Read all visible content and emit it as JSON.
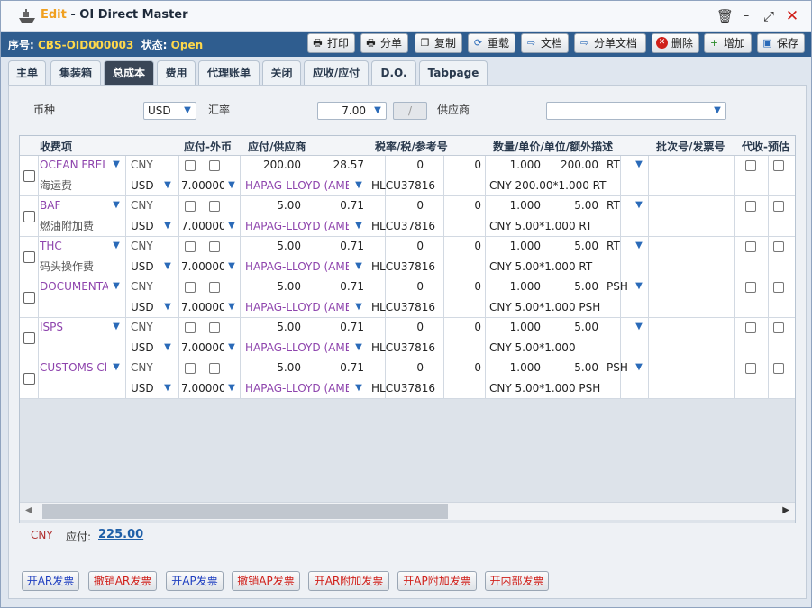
{
  "window": {
    "mode": "Edit",
    "title": " - OI Direct Master"
  },
  "record": {
    "no_label": "序号:",
    "no_value": "CBS-OID000003",
    "status_label": "状态:",
    "status_value": "Open"
  },
  "toolbar": [
    "打印",
    "分单",
    "复制",
    "重载",
    "文档",
    "分单文档",
    "删除",
    "增加",
    "保存"
  ],
  "tabs": [
    "主单",
    "集装箱",
    "总成本",
    "费用",
    "代理账单",
    "关闭",
    "应收/应付",
    "D.O.",
    "Tabpage"
  ],
  "active_tab": "总成本",
  "filters": {
    "currency_label": "币种",
    "currency": "USD",
    "rate_label": "汇率",
    "rate": "7.00",
    "rate_div": "/",
    "supplier_label": "供应商",
    "supplier": ""
  },
  "grid": {
    "headers": [
      "收费项",
      "应付-外币",
      "应付/供应商",
      "税率/税/参考号",
      "数量/单价/单位/额外描述",
      "批次号/发票号",
      "代收-预估"
    ],
    "rows": [
      {
        "item": "OCEAN FREI",
        "desc": "海运费",
        "cur": "CNY",
        "cur2": "USD",
        "rate": "7.00000",
        "amount": "200.00",
        "amount2": "28.57",
        "supplier": "HAPAG-LLOYD (AME",
        "tax": "0",
        "tax2": "0",
        "ref": "HLCU37816",
        "qty": "1.000",
        "price": "200.00",
        "unit": "RT",
        "extra": "CNY 200.00*1.000 RT"
      },
      {
        "item": "BAF",
        "desc": "燃油附加费",
        "cur": "CNY",
        "cur2": "USD",
        "rate": "7.00000",
        "amount": "5.00",
        "amount2": "0.71",
        "supplier": "HAPAG-LLOYD (AME",
        "tax": "0",
        "tax2": "0",
        "ref": "HLCU37816",
        "qty": "1.000",
        "price": "5.00",
        "unit": "RT",
        "extra": "CNY 5.00*1.000 RT"
      },
      {
        "item": "THC",
        "desc": "码头操作费",
        "cur": "CNY",
        "cur2": "USD",
        "rate": "7.00000",
        "amount": "5.00",
        "amount2": "0.71",
        "supplier": "HAPAG-LLOYD (AME",
        "tax": "0",
        "tax2": "0",
        "ref": "HLCU37816",
        "qty": "1.000",
        "price": "5.00",
        "unit": "RT",
        "extra": "CNY 5.00*1.000 RT"
      },
      {
        "item": "DOCUMENTA",
        "desc": "",
        "cur": "CNY",
        "cur2": "USD",
        "rate": "7.00000",
        "amount": "5.00",
        "amount2": "0.71",
        "supplier": "HAPAG-LLOYD (AME",
        "tax": "0",
        "tax2": "0",
        "ref": "HLCU37816",
        "qty": "1.000",
        "price": "5.00",
        "unit": "PSH",
        "extra": "CNY 5.00*1.000 PSH"
      },
      {
        "item": "ISPS",
        "desc": "",
        "cur": "CNY",
        "cur2": "USD",
        "rate": "7.00000",
        "amount": "5.00",
        "amount2": "0.71",
        "supplier": "HAPAG-LLOYD (AME",
        "tax": "0",
        "tax2": "0",
        "ref": "HLCU37816",
        "qty": "1.000",
        "price": "5.00",
        "unit": "",
        "extra": "CNY 5.00*1.000"
      },
      {
        "item": "CUSTOMS Cl",
        "desc": "",
        "cur": "CNY",
        "cur2": "USD",
        "rate": "7.00000",
        "amount": "5.00",
        "amount2": "0.71",
        "supplier": "HAPAG-LLOYD (AME",
        "tax": "0",
        "tax2": "0",
        "ref": "HLCU37816",
        "qty": "1.000",
        "price": "5.00",
        "unit": "PSH",
        "extra": "CNY 5.00*1.000 PSH"
      }
    ]
  },
  "summary": {
    "currency": "CNY",
    "payable_label": "应付:",
    "payable": "225.00"
  },
  "bottom_buttons": [
    "开AR发票",
    "撤销AR发票",
    "开AP发票",
    "撤销AP发票",
    "开AR附加发票",
    "开AP附加发票",
    "开内部发票"
  ],
  "colors": {
    "header": "#2f5d8f",
    "supplier": "#8e44ad",
    "accent": "#2a6ab8"
  }
}
